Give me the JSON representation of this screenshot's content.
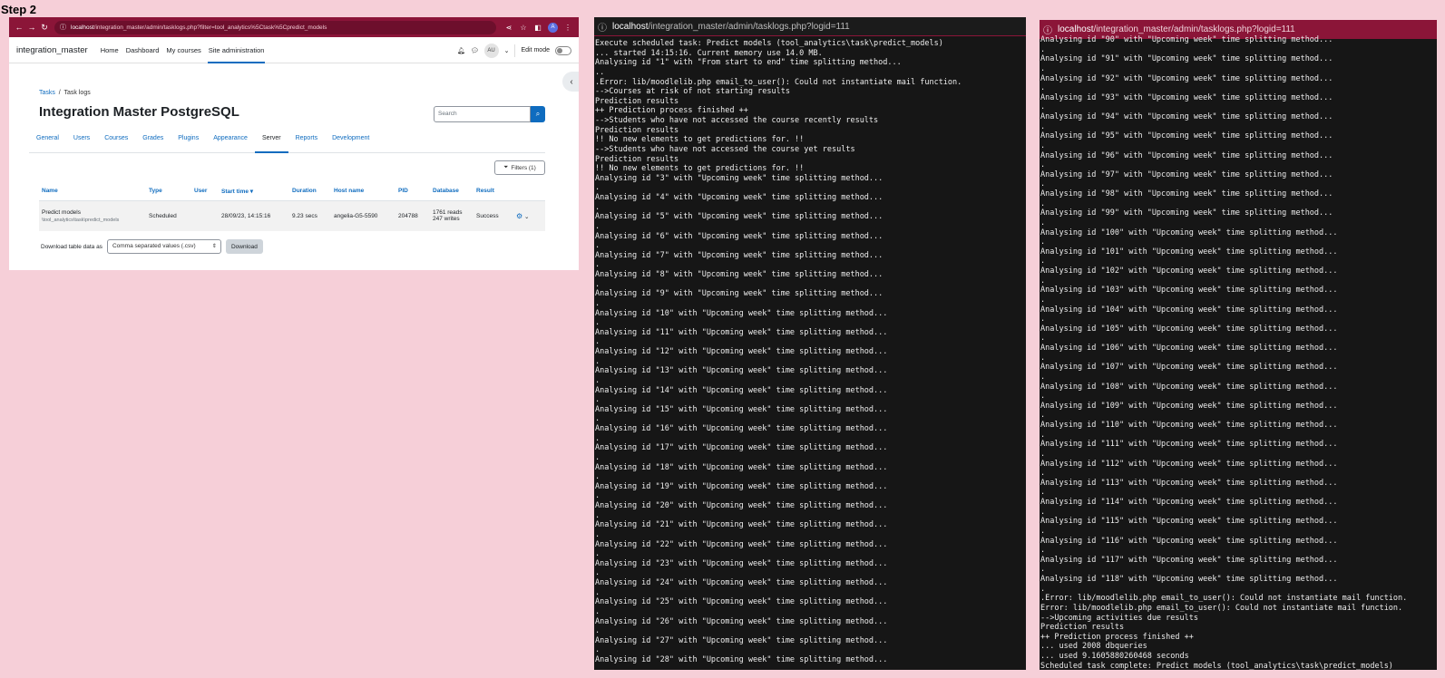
{
  "step_label": "Step 2",
  "browser": {
    "url_host": "localhost",
    "url_path": "/integration_master/admin/tasklogs.php?filter=tool_analytics%5Ctask%5Cpredict_models",
    "profile_letter": "A"
  },
  "moodle": {
    "site_name": "integration_master",
    "nav": [
      "Home",
      "Dashboard",
      "My courses",
      "Site administration"
    ],
    "user_initials": "AU",
    "edit_mode_label": "Edit mode",
    "breadcrumb": [
      "Tasks",
      "Task logs"
    ],
    "page_title": "Integration Master PostgreSQL",
    "search_placeholder": "Search",
    "tabs": [
      "General",
      "Users",
      "Courses",
      "Grades",
      "Plugins",
      "Appearance",
      "Server",
      "Reports",
      "Development"
    ],
    "filters_label": "Filters (1)",
    "table": {
      "headers": [
        "Name",
        "Type",
        "User",
        "Start time",
        "Duration",
        "Host name",
        "PID",
        "Database",
        "Result"
      ],
      "row": {
        "name": "Predict models",
        "name_sub": "\\tool_analytics\\task\\predict_models",
        "type": "Scheduled",
        "user": "",
        "start_time": "28/09/23, 14:15:16",
        "duration": "9.23 secs",
        "host": "angelia-G5-5590",
        "pid": "204788",
        "db_reads": "1761 reads",
        "db_writes": "247 writes",
        "result": "Success"
      }
    },
    "download_label": "Download table data as",
    "download_format": "Comma separated values (.csv)",
    "download_button": "Download"
  },
  "term1": {
    "host": "localhost",
    "path": "/integration_master/admin/tasklogs.php?logid=111",
    "lines": [
      "Execute scheduled task: Predict models (tool_analytics\\task\\predict_models)",
      "... started 14:15:16. Current memory use 14.0 MB.",
      "Analysing id \"1\" with \"From start to end\" time splitting method...",
      "..",
      ".Error: lib/moodlelib.php email_to_user(): Could not instantiate mail function.",
      "-->Courses at risk of not starting results",
      "Prediction results",
      "++ Prediction process finished ++",
      "-->Students who have not accessed the course recently results",
      "Prediction results",
      "!! No new elements to get predictions for. !!",
      "-->Students who have not accessed the course yet results",
      "Prediction results",
      "!! No new elements to get predictions for. !!",
      "Analysing id \"3\" with \"Upcoming week\" time splitting method...",
      ".",
      "Analysing id \"4\" with \"Upcoming week\" time splitting method...",
      ".",
      "Analysing id \"5\" with \"Upcoming week\" time splitting method...",
      ".",
      "Analysing id \"6\" with \"Upcoming week\" time splitting method...",
      ".",
      "Analysing id \"7\" with \"Upcoming week\" time splitting method...",
      ".",
      "Analysing id \"8\" with \"Upcoming week\" time splitting method...",
      ".",
      "Analysing id \"9\" with \"Upcoming week\" time splitting method...",
      ".",
      "Analysing id \"10\" with \"Upcoming week\" time splitting method...",
      ".",
      "Analysing id \"11\" with \"Upcoming week\" time splitting method...",
      ".",
      "Analysing id \"12\" with \"Upcoming week\" time splitting method...",
      ".",
      "Analysing id \"13\" with \"Upcoming week\" time splitting method...",
      ".",
      "Analysing id \"14\" with \"Upcoming week\" time splitting method...",
      ".",
      "Analysing id \"15\" with \"Upcoming week\" time splitting method...",
      ".",
      "Analysing id \"16\" with \"Upcoming week\" time splitting method...",
      ".",
      "Analysing id \"17\" with \"Upcoming week\" time splitting method...",
      ".",
      "Analysing id \"18\" with \"Upcoming week\" time splitting method...",
      ".",
      "Analysing id \"19\" with \"Upcoming week\" time splitting method...",
      ".",
      "Analysing id \"20\" with \"Upcoming week\" time splitting method...",
      ".",
      "Analysing id \"21\" with \"Upcoming week\" time splitting method...",
      ".",
      "Analysing id \"22\" with \"Upcoming week\" time splitting method...",
      ".",
      "Analysing id \"23\" with \"Upcoming week\" time splitting method...",
      ".",
      "Analysing id \"24\" with \"Upcoming week\" time splitting method...",
      ".",
      "Analysing id \"25\" with \"Upcoming week\" time splitting method...",
      ".",
      "Analysing id \"26\" with \"Upcoming week\" time splitting method...",
      ".",
      "Analysing id \"27\" with \"Upcoming week\" time splitting method...",
      ".",
      "Analysing id \"28\" with \"Upcoming week\" time splitting method..."
    ]
  },
  "term2": {
    "host": "localhost",
    "path": "/integration_master/admin/tasklogs.php?logid=111",
    "lines": [
      "Analysing id \"90\" with \"Upcoming week\" time splitting method...",
      ".",
      "Analysing id \"91\" with \"Upcoming week\" time splitting method...",
      ".",
      "Analysing id \"92\" with \"Upcoming week\" time splitting method...",
      ".",
      "Analysing id \"93\" with \"Upcoming week\" time splitting method...",
      ".",
      "Analysing id \"94\" with \"Upcoming week\" time splitting method...",
      ".",
      "Analysing id \"95\" with \"Upcoming week\" time splitting method...",
      ".",
      "Analysing id \"96\" with \"Upcoming week\" time splitting method...",
      ".",
      "Analysing id \"97\" with \"Upcoming week\" time splitting method...",
      ".",
      "Analysing id \"98\" with \"Upcoming week\" time splitting method...",
      ".",
      "Analysing id \"99\" with \"Upcoming week\" time splitting method...",
      ".",
      "Analysing id \"100\" with \"Upcoming week\" time splitting method...",
      ".",
      "Analysing id \"101\" with \"Upcoming week\" time splitting method...",
      ".",
      "Analysing id \"102\" with \"Upcoming week\" time splitting method...",
      ".",
      "Analysing id \"103\" with \"Upcoming week\" time splitting method...",
      ".",
      "Analysing id \"104\" with \"Upcoming week\" time splitting method...",
      ".",
      "Analysing id \"105\" with \"Upcoming week\" time splitting method...",
      ".",
      "Analysing id \"106\" with \"Upcoming week\" time splitting method...",
      ".",
      "Analysing id \"107\" with \"Upcoming week\" time splitting method...",
      ".",
      "Analysing id \"108\" with \"Upcoming week\" time splitting method...",
      ".",
      "Analysing id \"109\" with \"Upcoming week\" time splitting method...",
      ".",
      "Analysing id \"110\" with \"Upcoming week\" time splitting method...",
      ".",
      "Analysing id \"111\" with \"Upcoming week\" time splitting method...",
      ".",
      "Analysing id \"112\" with \"Upcoming week\" time splitting method...",
      ".",
      "Analysing id \"113\" with \"Upcoming week\" time splitting method...",
      ".",
      "Analysing id \"114\" with \"Upcoming week\" time splitting method...",
      ".",
      "Analysing id \"115\" with \"Upcoming week\" time splitting method...",
      ".",
      "Analysing id \"116\" with \"Upcoming week\" time splitting method...",
      ".",
      "Analysing id \"117\" with \"Upcoming week\" time splitting method...",
      ".",
      "Analysing id \"118\" with \"Upcoming week\" time splitting method...",
      ".",
      ".Error: lib/moodlelib.php email_to_user(): Could not instantiate mail function.",
      "Error: lib/moodlelib.php email_to_user(): Could not instantiate mail function.",
      "-->Upcoming activities due results",
      "Prediction results",
      "++ Prediction process finished ++",
      "... used 2008 dbqueries",
      "... used 9.1605880260468 seconds",
      "Scheduled task complete: Predict models (tool_analytics\\task\\predict_models)"
    ]
  }
}
